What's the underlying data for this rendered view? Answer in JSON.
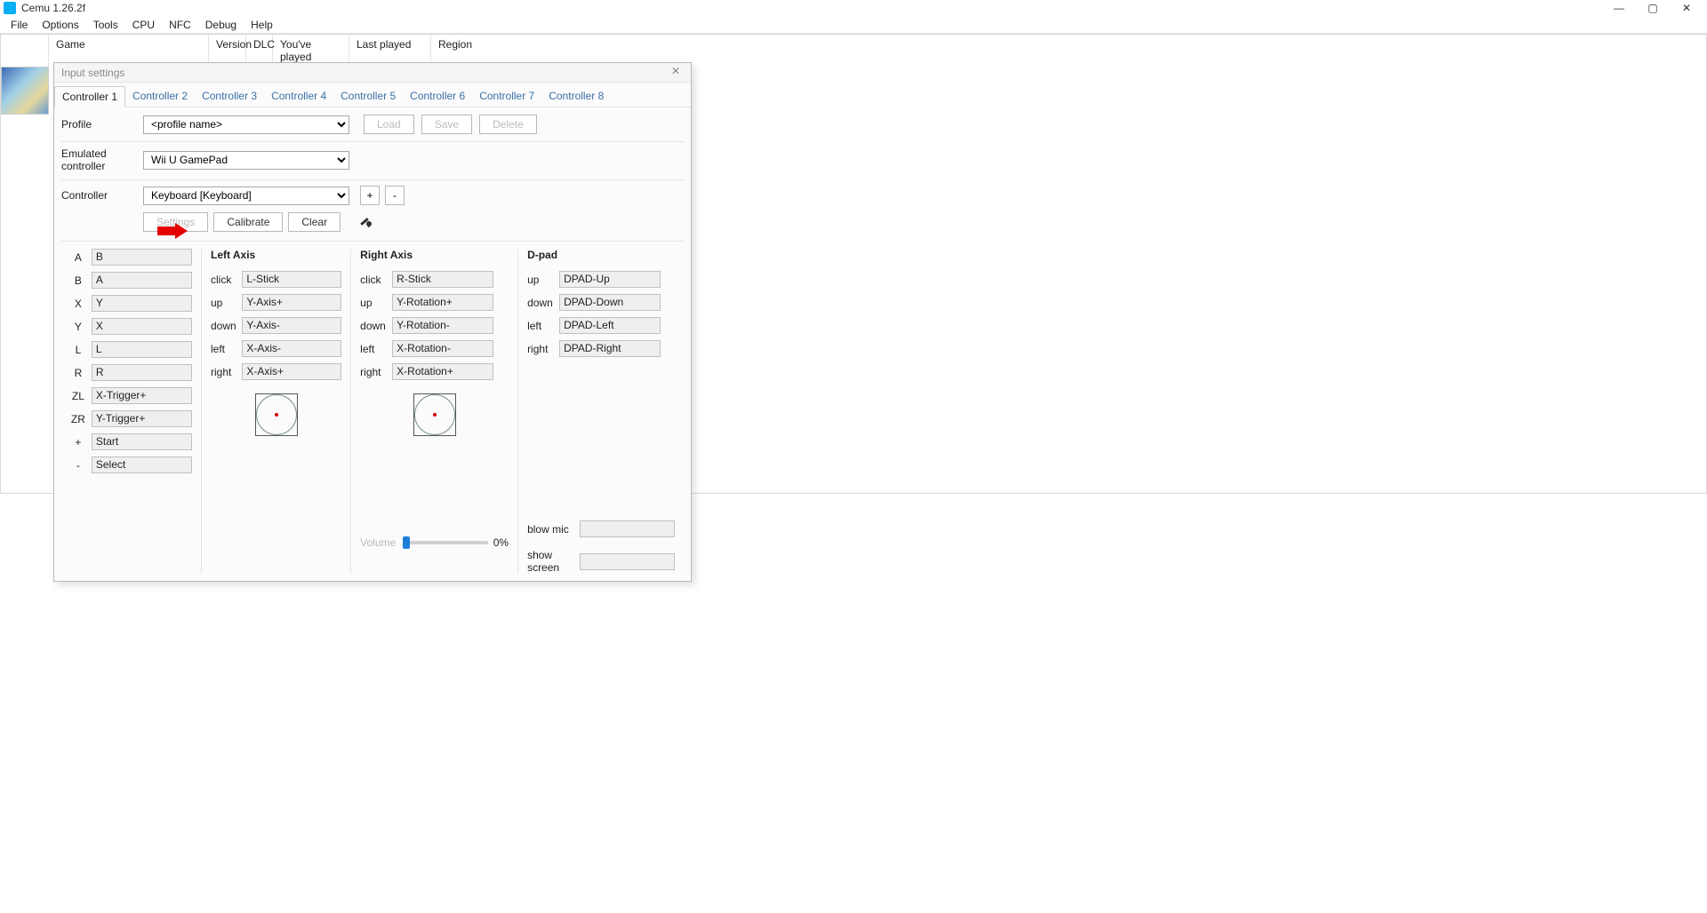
{
  "app": {
    "title": "Cemu 1.26.2f"
  },
  "menu": [
    "File",
    "Options",
    "Tools",
    "CPU",
    "NFC",
    "Debug",
    "Help"
  ],
  "table": {
    "cols": [
      "Game",
      "Version",
      "DLC",
      "You've played",
      "Last played",
      "Region"
    ]
  },
  "dialog": {
    "title": "Input settings",
    "tabs": [
      "Controller 1",
      "Controller 2",
      "Controller 3",
      "Controller 4",
      "Controller 5",
      "Controller 6",
      "Controller 7",
      "Controller 8"
    ],
    "active_tab": 0,
    "profile_label": "Profile",
    "profile_value": "<profile name>",
    "load": "Load",
    "save": "Save",
    "delete": "Delete",
    "emu_label": "Emulated controller",
    "emu_value": "Wii U GamePad",
    "ctrl_label": "Controller",
    "ctrl_value": "Keyboard [Keyboard]",
    "add": "+",
    "remove": "-",
    "settings": "Settings",
    "calibrate": "Calibrate",
    "clear": "Clear",
    "face": [
      {
        "l": "A",
        "v": "B"
      },
      {
        "l": "B",
        "v": "A"
      },
      {
        "l": "X",
        "v": "Y"
      },
      {
        "l": "Y",
        "v": "X"
      },
      {
        "l": "L",
        "v": "L"
      },
      {
        "l": "R",
        "v": "R"
      },
      {
        "l": "ZL",
        "v": "X-Trigger+"
      },
      {
        "l": "ZR",
        "v": "Y-Trigger+"
      },
      {
        "l": "+",
        "v": "Start"
      },
      {
        "l": "-",
        "v": "Select"
      }
    ],
    "left_axis": {
      "title": "Left Axis",
      "rows": [
        {
          "l": "click",
          "v": "L-Stick"
        },
        {
          "l": "up",
          "v": "Y-Axis+"
        },
        {
          "l": "down",
          "v": "Y-Axis-"
        },
        {
          "l": "left",
          "v": "X-Axis-"
        },
        {
          "l": "right",
          "v": "X-Axis+"
        }
      ]
    },
    "right_axis": {
      "title": "Right Axis",
      "rows": [
        {
          "l": "click",
          "v": "R-Stick"
        },
        {
          "l": "up",
          "v": "Y-Rotation+"
        },
        {
          "l": "down",
          "v": "Y-Rotation-"
        },
        {
          "l": "left",
          "v": "X-Rotation-"
        },
        {
          "l": "right",
          "v": "X-Rotation+"
        }
      ],
      "volume_label": "Volume",
      "volume_text": "0%"
    },
    "dpad": {
      "title": "D-pad",
      "rows": [
        {
          "l": "up",
          "v": "DPAD-Up"
        },
        {
          "l": "down",
          "v": "DPAD-Down"
        },
        {
          "l": "left",
          "v": "DPAD-Left"
        },
        {
          "l": "right",
          "v": "DPAD-Right"
        }
      ],
      "blow": "blow mic",
      "show": "show screen"
    }
  },
  "win_btns": {
    "min": "—",
    "max": "▢",
    "close": "✕"
  }
}
